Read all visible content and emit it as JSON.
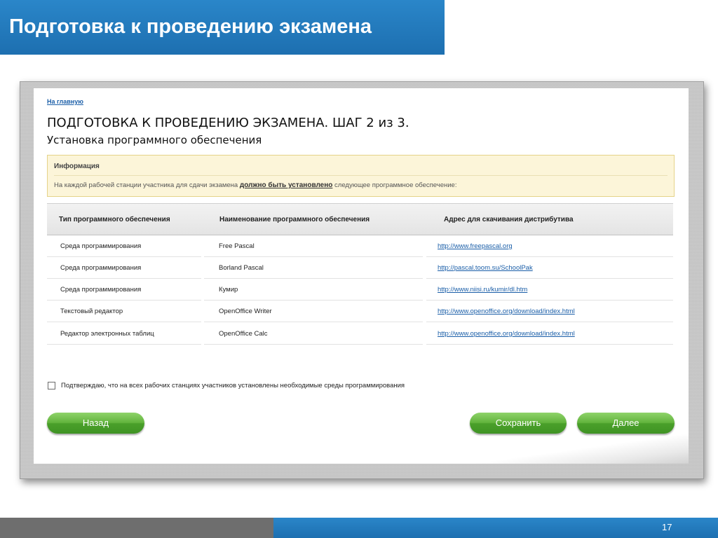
{
  "slide": {
    "title": "Подготовка к проведению экзамена",
    "page_number": "17"
  },
  "app": {
    "home_link": "На главную",
    "heading": "ПОДГОТОВКА К ПРОВЕДЕНИЮ ЭКЗАМЕНА. ШАГ 2 из 3.",
    "subheading": "Установка программного обеспечения",
    "info": {
      "title": "Информация",
      "text_before": "На каждой рабочей станции участника для сдачи экзамена ",
      "text_bold": "должно быть установлено",
      "text_after": " следующее программное обеспечение:"
    },
    "table": {
      "columns": [
        "Тип программного обеспечения",
        "Наименование программного обеспечения",
        "Адрес для скачивания дистрибутива"
      ],
      "rows": [
        {
          "type": "Среда программирования",
          "name": "Free Pascal",
          "url": "http://www.freepascal.org"
        },
        {
          "type": "Среда программирования",
          "name": "Borland Pascal",
          "url": "http://pascal.toom.su/SchoolPak"
        },
        {
          "type": "Среда программирования",
          "name": "Кумир",
          "url": "http://www.niisi.ru/kumir/dl.htm"
        },
        {
          "type": "Текстовый редактор",
          "name": "OpenOffice Writer",
          "url": "http://www.openoffice.org/download/index.html"
        },
        {
          "type": "Редактор электронных таблиц",
          "name": "OpenOffice Calc",
          "url": "http://www.openoffice.org/download/index.html"
        }
      ]
    },
    "confirm": {
      "label": "Подтверждаю, что на всех рабочих станциях участников установлены необходимые среды программирования",
      "checked": false
    },
    "buttons": {
      "back": "Назад",
      "save": "Сохранить",
      "next": "Далее"
    }
  },
  "colors": {
    "accent_blue": "#1d6fb0",
    "button_green": "#4aa02a",
    "info_bg": "#fcf5d9",
    "link": "#1a5ea8"
  }
}
